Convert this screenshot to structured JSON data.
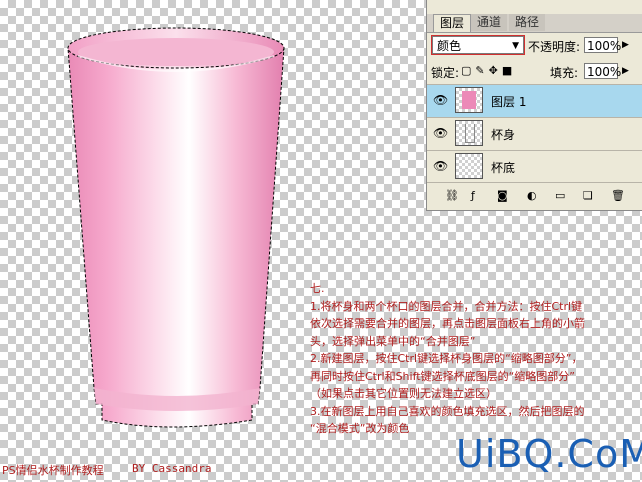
{
  "panel": {
    "tabs": [
      "图层",
      "通道",
      "路径"
    ],
    "blend_mode": "颜色",
    "opacity_label": "不透明度:",
    "opacity_value": "100%",
    "lock_label": "锁定:",
    "fill_label": "填充:",
    "fill_value": "100%",
    "layers": [
      {
        "name": "图层 1",
        "selected": true
      },
      {
        "name": "杯身",
        "selected": false
      },
      {
        "name": "杯底",
        "selected": false
      }
    ]
  },
  "instructions": [
    "七.",
    "1.将杯身和两个杯口的图层合并，合并方法：按住Ctrl键",
    "依次选择需要合并的图层，再点击图层面板右上角的小箭",
    "头，选择弹出菜单中的“合并图层”",
    "2.新建图层，按住Ctrl键选择杯身图层的“缩略图部分”，",
    "再同时按住Ctrl和Shift键选择杯底图层的“缩略图部分”",
    "（如果点击其它位置则无法建立选区）",
    "3.在新图层上用自己喜欢的颜色填充选区，然后把图层的",
    "“混合模式”改为颜色"
  ],
  "footer": {
    "title": "PS情侣水杯制作教程",
    "author": "BY Cassandra"
  },
  "watermark": "UiBQ.CoM",
  "colors": {
    "cup_pink": "#ee8cbc",
    "text_red": "#b02020",
    "selected_layer": "#a8d8ee"
  }
}
